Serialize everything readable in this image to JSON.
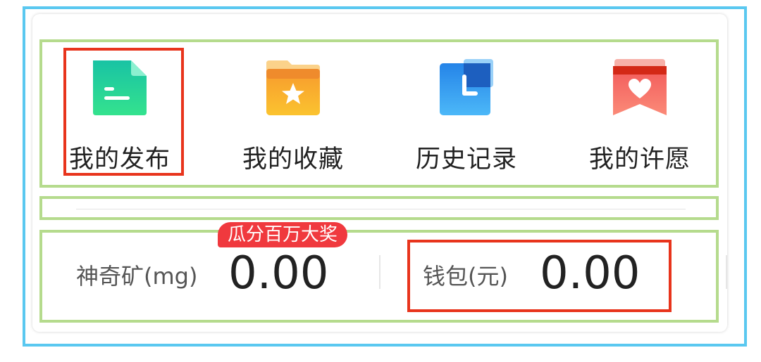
{
  "menu": {
    "items": [
      {
        "label": "我的发布",
        "icon": "document-icon"
      },
      {
        "label": "我的收藏",
        "icon": "folder-star-icon"
      },
      {
        "label": "历史记录",
        "icon": "clock-icon"
      },
      {
        "label": "我的许愿",
        "icon": "heart-bookmark-icon"
      }
    ]
  },
  "stats": {
    "badge": "瓜分百万大奖",
    "magic_ore": {
      "label": "神奇矿(mg)",
      "value": "0.00"
    },
    "wallet": {
      "label": "钱包(元)",
      "value": "0.00"
    }
  },
  "colors": {
    "outer_frame": "#5ac8f0",
    "green_box": "#b5db8d",
    "red_box": "#e8341c",
    "badge_bg": "#f0393e"
  }
}
